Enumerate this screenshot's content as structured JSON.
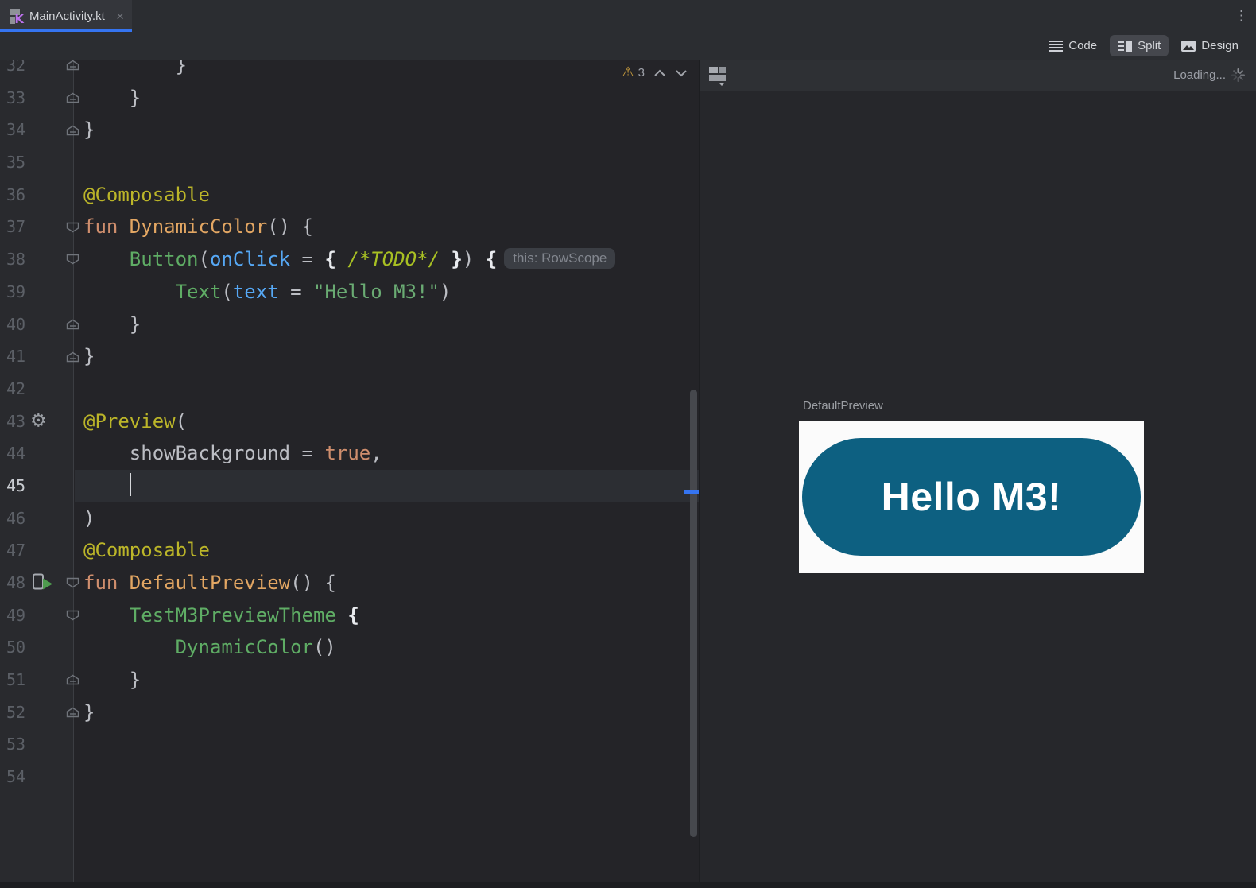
{
  "window": {
    "tab": {
      "label": "MainActivity.kt",
      "close_glyph": "×"
    },
    "kebab_glyph": "⋮"
  },
  "view_toggle": {
    "code_label": "Code",
    "split_label": "Split",
    "design_label": "Design",
    "active": "Split"
  },
  "editor": {
    "warning_glyph": "⚠",
    "warning_count": "3",
    "gear_glyph": "⚙",
    "lines": [
      {
        "num": "32",
        "gutter": [
          "fold-end"
        ],
        "segs": [
          [
            "t",
            "        }"
          ]
        ]
      },
      {
        "num": "33",
        "gutter": [
          "fold-end"
        ],
        "segs": [
          [
            "t",
            "    }"
          ]
        ]
      },
      {
        "num": "34",
        "gutter": [
          "fold-end"
        ],
        "segs": [
          [
            "t",
            "}"
          ]
        ]
      },
      {
        "num": "35"
      },
      {
        "num": "36",
        "segs": [
          [
            "a",
            "@Composable"
          ]
        ]
      },
      {
        "num": "37",
        "gutter": [
          "fold-start"
        ],
        "segs": [
          [
            "k",
            "fun "
          ],
          [
            "d",
            "DynamicColor"
          ],
          [
            "t",
            "() {"
          ]
        ]
      },
      {
        "num": "38",
        "gutter": [
          "fold-start"
        ],
        "segs": [
          [
            "t",
            "    "
          ],
          [
            "c",
            "Button"
          ],
          [
            "t",
            "("
          ],
          [
            "p",
            "onClick"
          ],
          [
            "t",
            " = "
          ],
          [
            "b",
            "{"
          ],
          [
            "t",
            " "
          ],
          [
            "td",
            "/*TODO*/"
          ],
          [
            "t",
            " "
          ],
          [
            "b",
            "}"
          ],
          [
            "t",
            ") "
          ],
          [
            "b",
            "{"
          ]
        ],
        "hint": "this: RowScope"
      },
      {
        "num": "39",
        "segs": [
          [
            "t",
            "        "
          ],
          [
            "c",
            "Text"
          ],
          [
            "t",
            "("
          ],
          [
            "p",
            "text"
          ],
          [
            "t",
            " = "
          ],
          [
            "s",
            "\"Hello M3!\""
          ],
          [
            "t",
            ")"
          ]
        ]
      },
      {
        "num": "40",
        "gutter": [
          "fold-end"
        ],
        "segs": [
          [
            "t",
            "    }"
          ]
        ]
      },
      {
        "num": "41",
        "gutter": [
          "fold-end"
        ],
        "segs": [
          [
            "t",
            "}"
          ]
        ]
      },
      {
        "num": "42"
      },
      {
        "num": "43",
        "gutter": [
          "gear"
        ],
        "segs": [
          [
            "a",
            "@Preview"
          ],
          [
            "t",
            "("
          ]
        ]
      },
      {
        "num": "44",
        "segs": [
          [
            "t",
            "    showBackground = "
          ],
          [
            "k",
            "true"
          ],
          [
            "t",
            ","
          ]
        ]
      },
      {
        "num": "45",
        "current": true,
        "caret": true,
        "segs": [
          [
            "t",
            "    "
          ]
        ]
      },
      {
        "num": "46",
        "segs": [
          [
            "t",
            ")"
          ]
        ]
      },
      {
        "num": "47",
        "segs": [
          [
            "a",
            "@Composable"
          ]
        ]
      },
      {
        "num": "48",
        "gutter": [
          "run",
          "fold-start"
        ],
        "segs": [
          [
            "k",
            "fun "
          ],
          [
            "d",
            "DefaultPreview"
          ],
          [
            "t",
            "() {"
          ]
        ]
      },
      {
        "num": "49",
        "gutter": [
          "fold-start"
        ],
        "segs": [
          [
            "t",
            "    "
          ],
          [
            "c",
            "TestM3PreviewTheme"
          ],
          [
            "t",
            " "
          ],
          [
            "b",
            "{"
          ]
        ]
      },
      {
        "num": "50",
        "segs": [
          [
            "t",
            "        "
          ],
          [
            "c",
            "DynamicColor"
          ],
          [
            "t",
            "()"
          ]
        ]
      },
      {
        "num": "51",
        "gutter": [
          "fold-end"
        ],
        "segs": [
          [
            "t",
            "    }"
          ]
        ]
      },
      {
        "num": "52",
        "gutter": [
          "fold-end"
        ],
        "segs": [
          [
            "t",
            "}"
          ]
        ]
      },
      {
        "num": "53"
      },
      {
        "num": "54"
      }
    ]
  },
  "preview": {
    "loading_text": "Loading...",
    "label": "DefaultPreview",
    "button_text": "Hello M3!"
  },
  "colors": {
    "accent": "#3574f0",
    "preview_button": "#0d6081",
    "warning": "#d9a93f",
    "composable_call": "#5fad65",
    "keyword": "#cf8e6d",
    "string": "#6aab73",
    "annotation": "#bbb529"
  }
}
